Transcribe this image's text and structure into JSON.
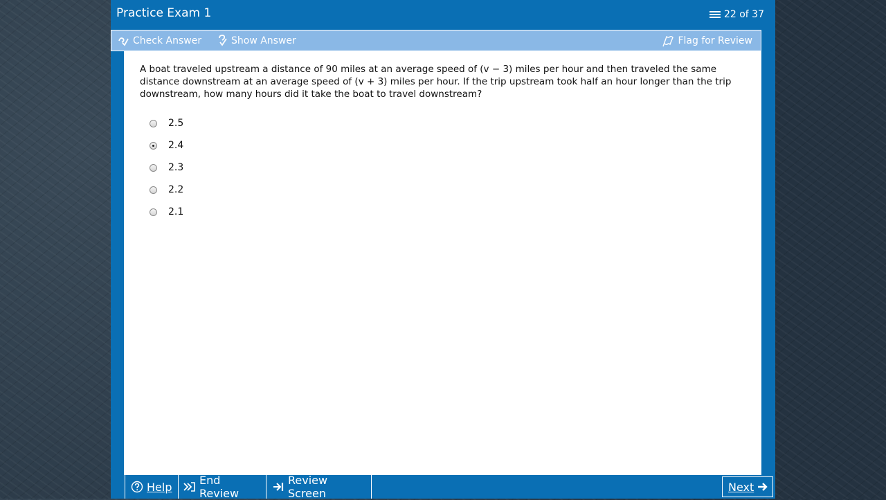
{
  "header": {
    "title": "Practice Exam 1",
    "counter": "22 of 37"
  },
  "toolbar": {
    "check_answer": "Check Answer",
    "show_answer": "Show Answer",
    "flag_for_review": "Flag for Review"
  },
  "question": {
    "text": "A boat traveled upstream a distance of 90 miles at an average speed of (v − 3) miles per hour and then traveled the same distance downstream at an average speed of (v + 3) miles per hour. If the trip upstream took half an hour longer than the trip downstream, how many hours did it take the boat to travel downstream?"
  },
  "options": [
    {
      "label": "2.5",
      "selected": false
    },
    {
      "label": "2.4",
      "selected": true
    },
    {
      "label": "2.3",
      "selected": false
    },
    {
      "label": "2.2",
      "selected": false
    },
    {
      "label": "2.1",
      "selected": false
    }
  ],
  "footer": {
    "help": "Help",
    "end_review": "End Review",
    "review_screen": "Review Screen",
    "next": "Next"
  },
  "colors": {
    "frame": "#0a6fb4",
    "toolbar": "#8ab8e6",
    "background": "#2b3a48"
  },
  "icons": {
    "counter": "list-icon",
    "check": "check-answer-icon",
    "show": "show-answer-icon",
    "flag": "flag-icon",
    "help": "help-circle-icon",
    "end_review": "end-review-icon",
    "review_screen": "review-screen-icon",
    "next": "arrow-right-icon"
  }
}
